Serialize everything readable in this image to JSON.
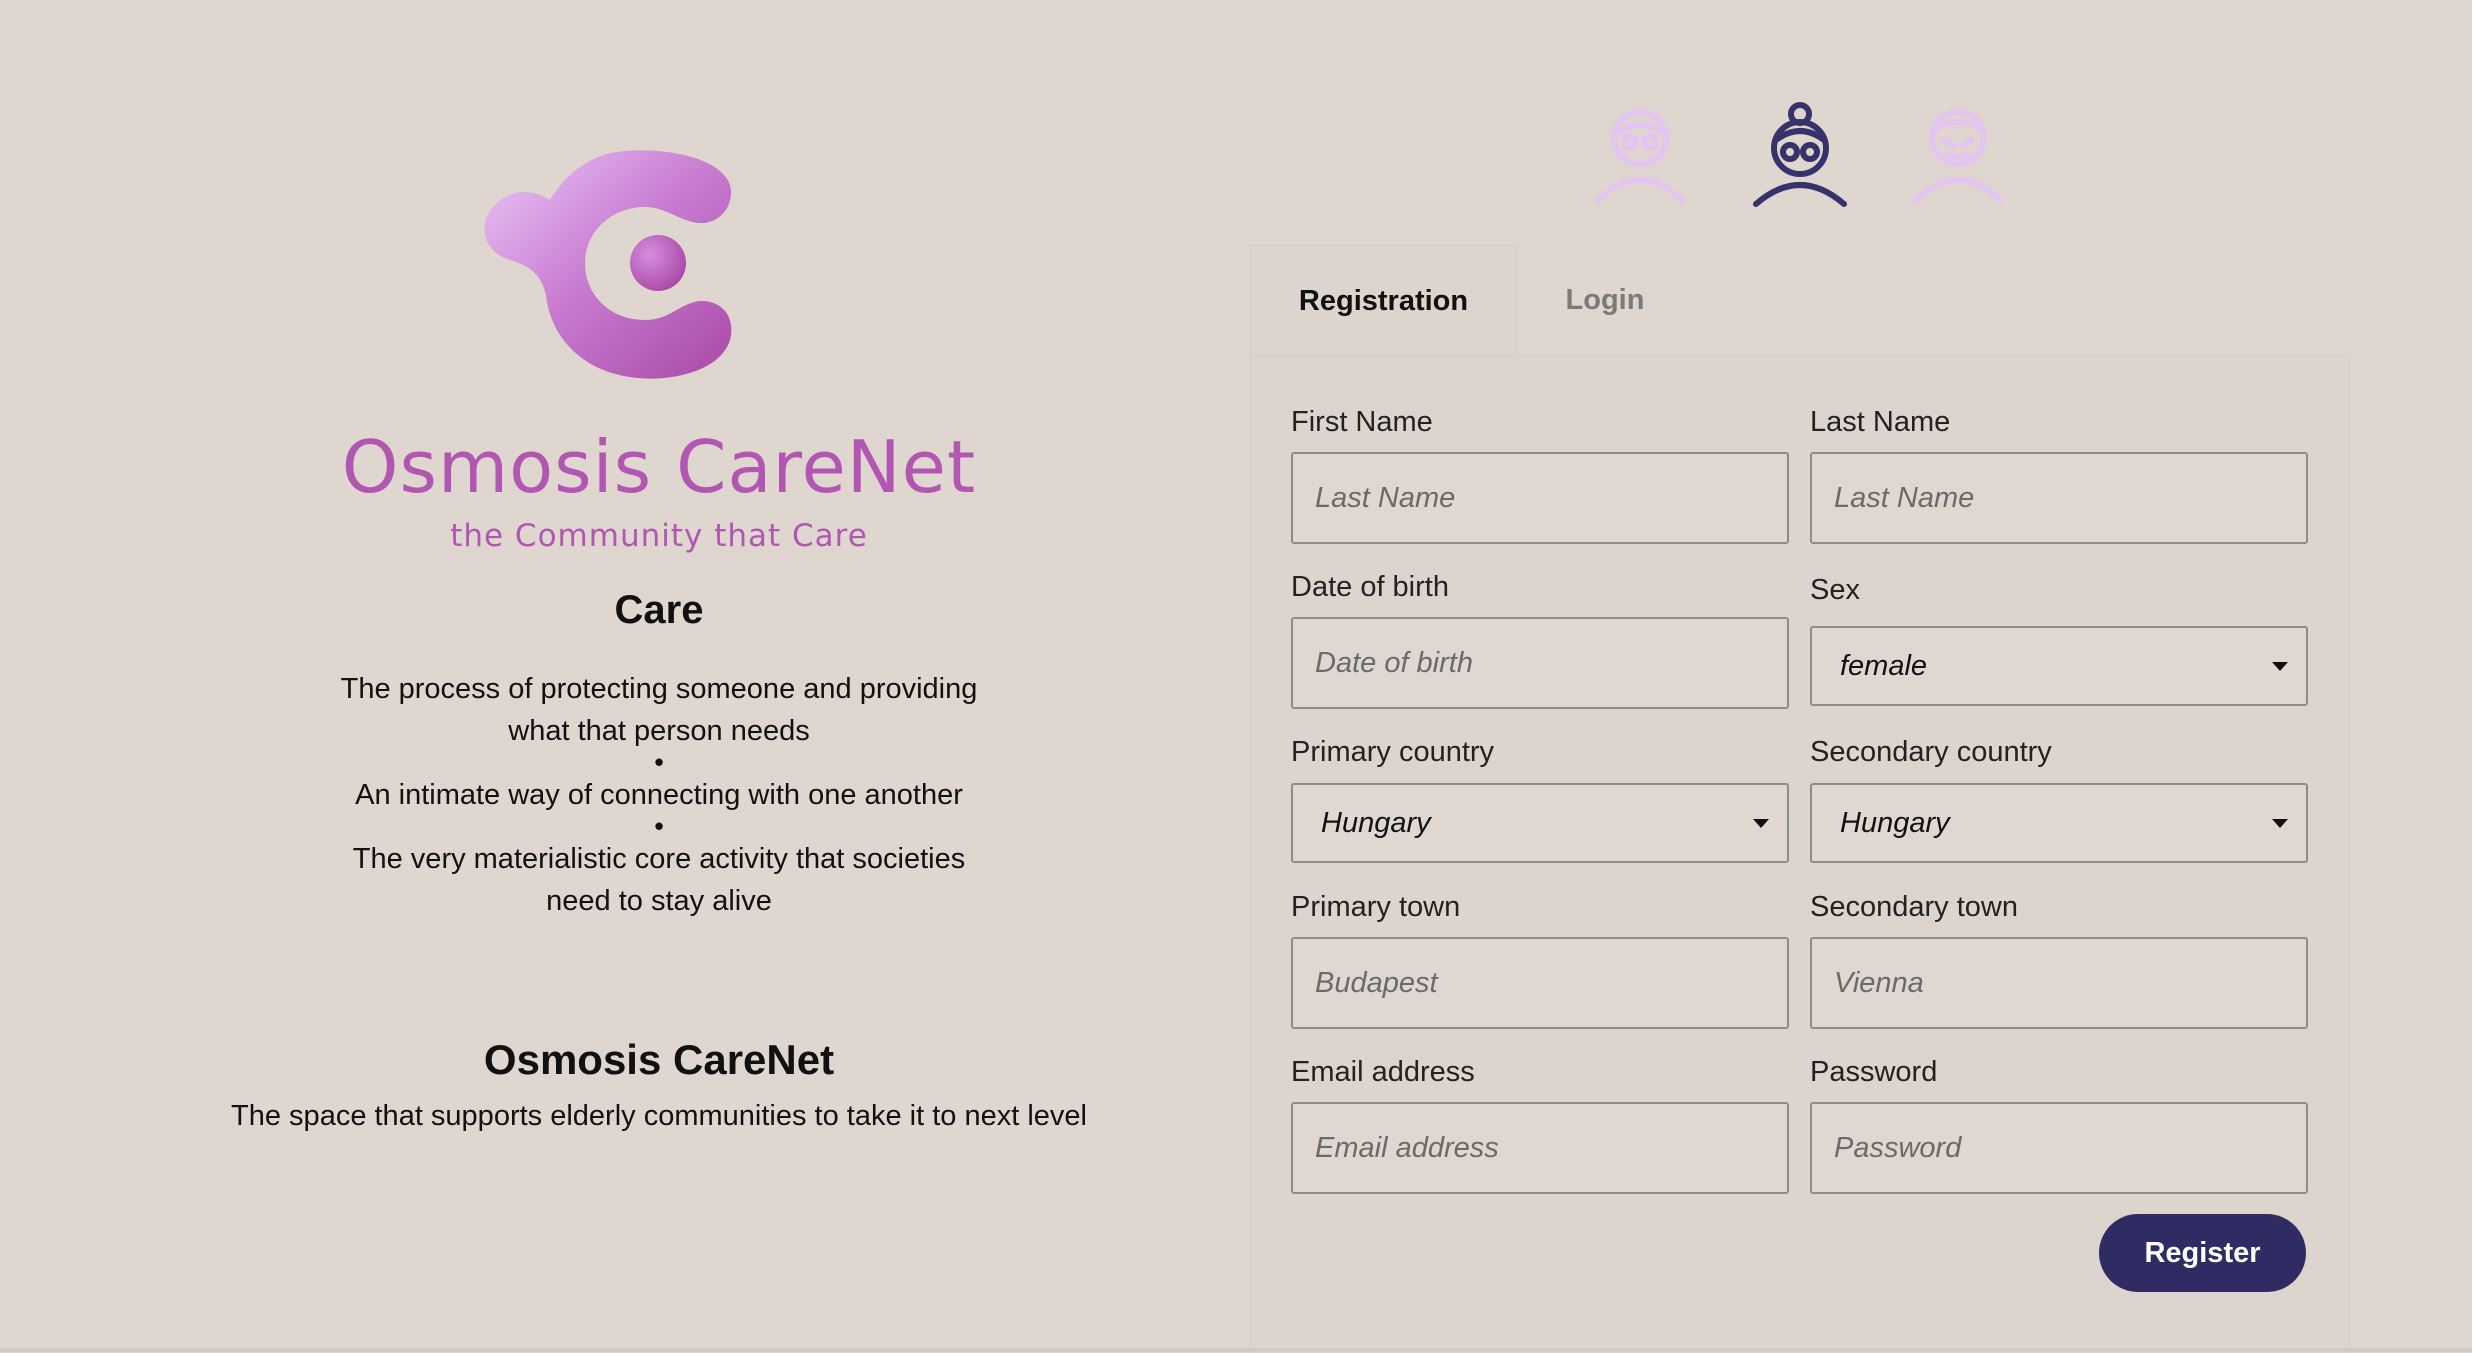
{
  "brand": {
    "name": "Osmosis CareNet",
    "tagline": "the Community that Care"
  },
  "care": {
    "title": "Care",
    "line1a": "The process of protecting someone and providing",
    "line1b": "what that person needs",
    "bullet": "•",
    "line2": "An intimate way of connecting with one another",
    "line3a": "The very materialistic core activity that societies",
    "line3b": "need to stay alive"
  },
  "about": {
    "title": "Osmosis CareNet",
    "description": "The space that supports elderly communities to take it to next level"
  },
  "avatars": [
    {
      "icon": "elderly-man-icon",
      "active": false
    },
    {
      "icon": "elderly-woman-icon",
      "active": true
    },
    {
      "icon": "elderly-person-icon",
      "active": false
    }
  ],
  "tabs": {
    "registration": "Registration",
    "login": "Login"
  },
  "form": {
    "first_name": {
      "label": "First Name",
      "placeholder": "Last Name"
    },
    "last_name": {
      "label": "Last Name",
      "placeholder": "Last Name"
    },
    "dob": {
      "label": "Date of birth",
      "placeholder": "Date of birth"
    },
    "sex": {
      "label": "Sex",
      "value": "female"
    },
    "primary_country": {
      "label": "Primary country",
      "value": "Hungary"
    },
    "secondary_country": {
      "label": "Secondary country",
      "value": "Hungary"
    },
    "primary_town": {
      "label": "Primary town",
      "placeholder": "Budapest"
    },
    "secondary_town": {
      "label": "Secondary town",
      "placeholder": "Vienna"
    },
    "email": {
      "label": "Email address",
      "placeholder": "Email address"
    },
    "password": {
      "label": "Password",
      "placeholder": "Password"
    },
    "register_label": "Register"
  },
  "colors": {
    "background": "#dfd6d0",
    "brand": "#b157b2",
    "button": "#2e2c62",
    "avatar_active": "#35336a",
    "avatar_inactive": "#e4c4f0"
  }
}
